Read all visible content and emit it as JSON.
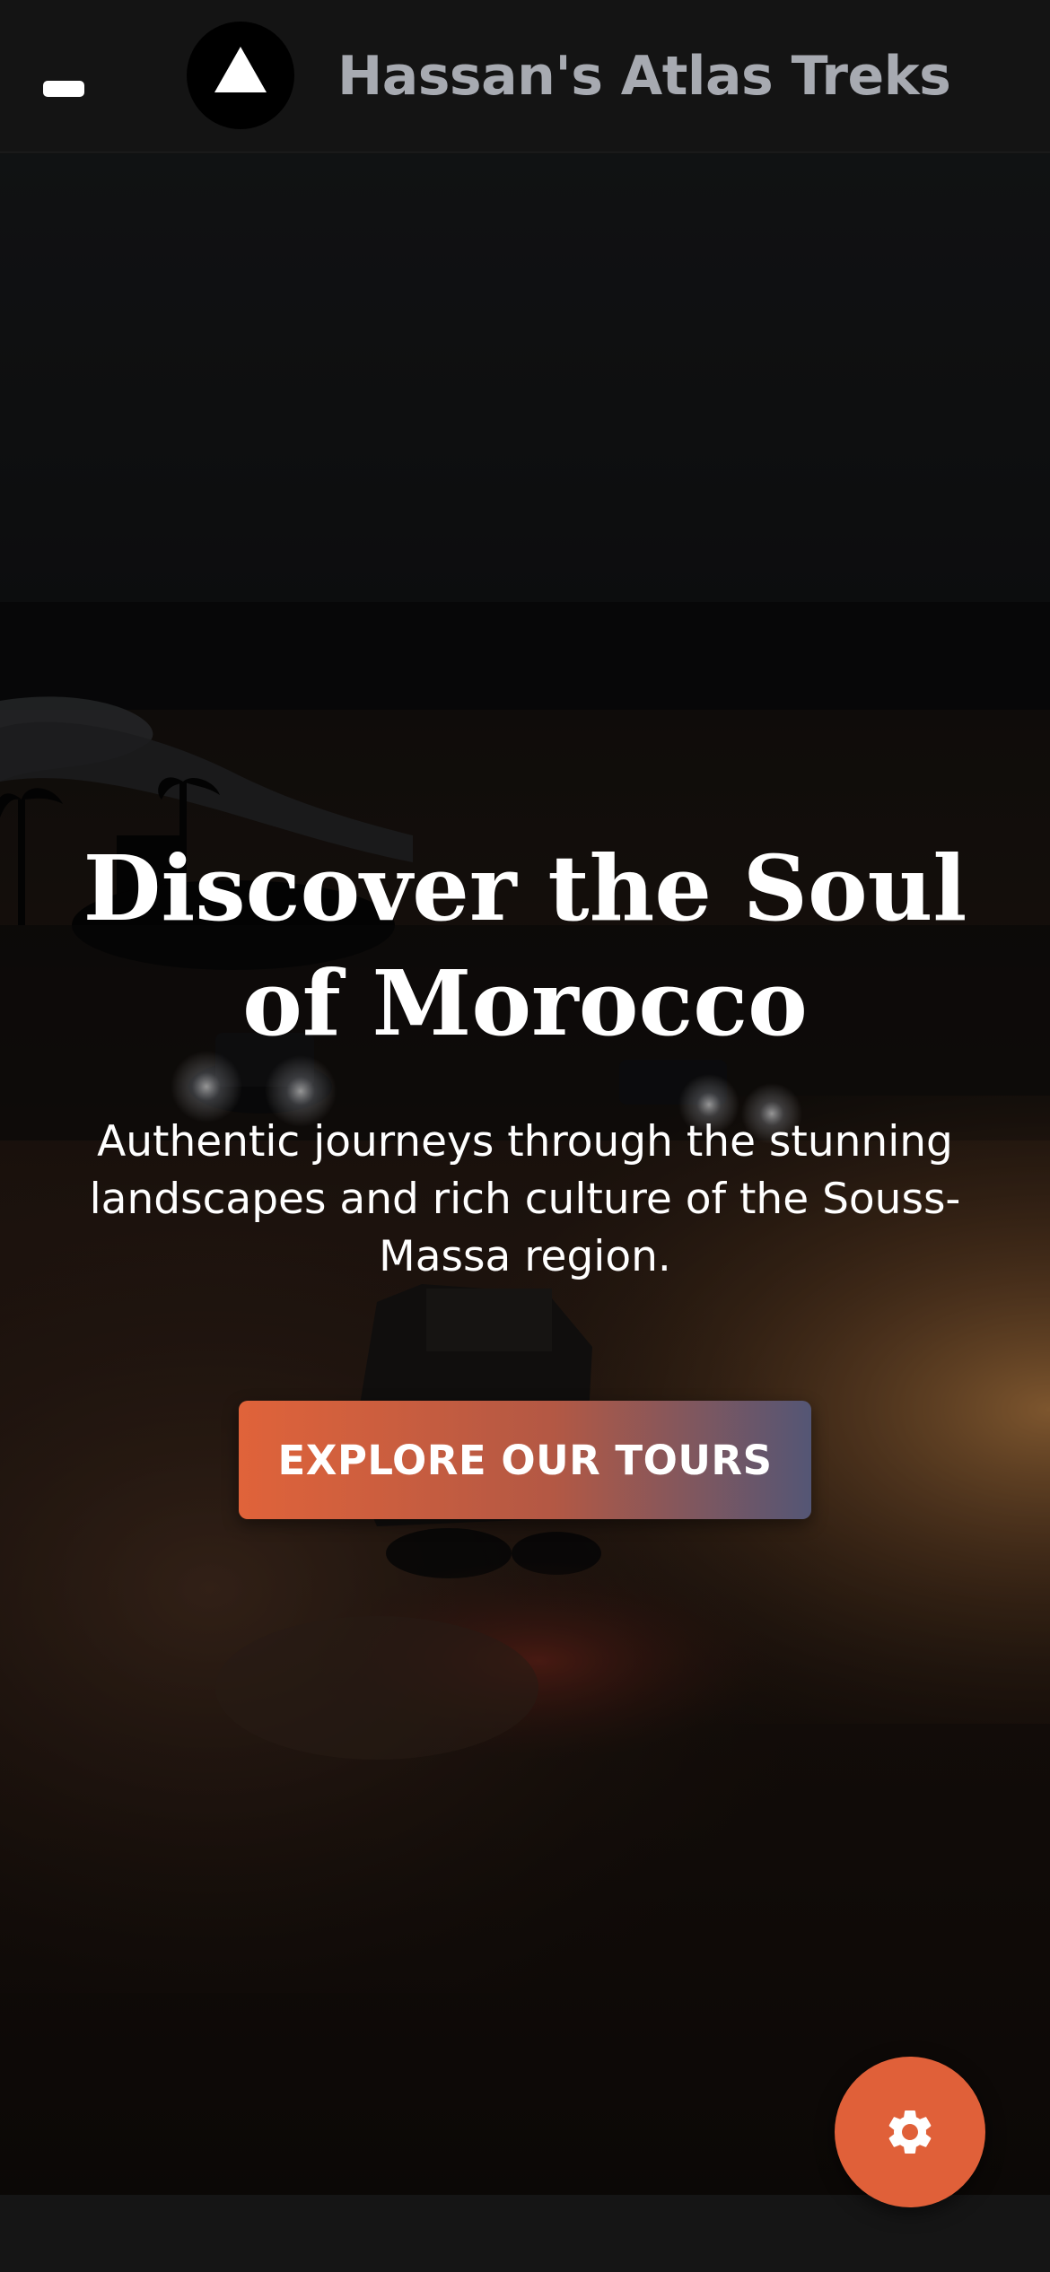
{
  "header": {
    "title": "Hassan's Atlas Treks",
    "menu_icon": "menu-icon",
    "logo_icon": "mountain-triangle-icon"
  },
  "hero": {
    "title": "Discover the Soul of Morocco",
    "subtitle": "Authentic journeys through the stunning landscapes and rich culture of the Souss-Massa region.",
    "cta_label": "EXPLORE OUR TOURS",
    "background_image": "night desert dunes with 4x4 vehicles and headlights"
  },
  "fab": {
    "icon": "gear-icon"
  },
  "colors": {
    "header_bg": "#141414",
    "brand_text": "#a7aab1",
    "accent": "#e06039",
    "cta_gradient_start": "#e0633a",
    "cta_gradient_end": "#545675",
    "text_light": "#ffffff"
  }
}
